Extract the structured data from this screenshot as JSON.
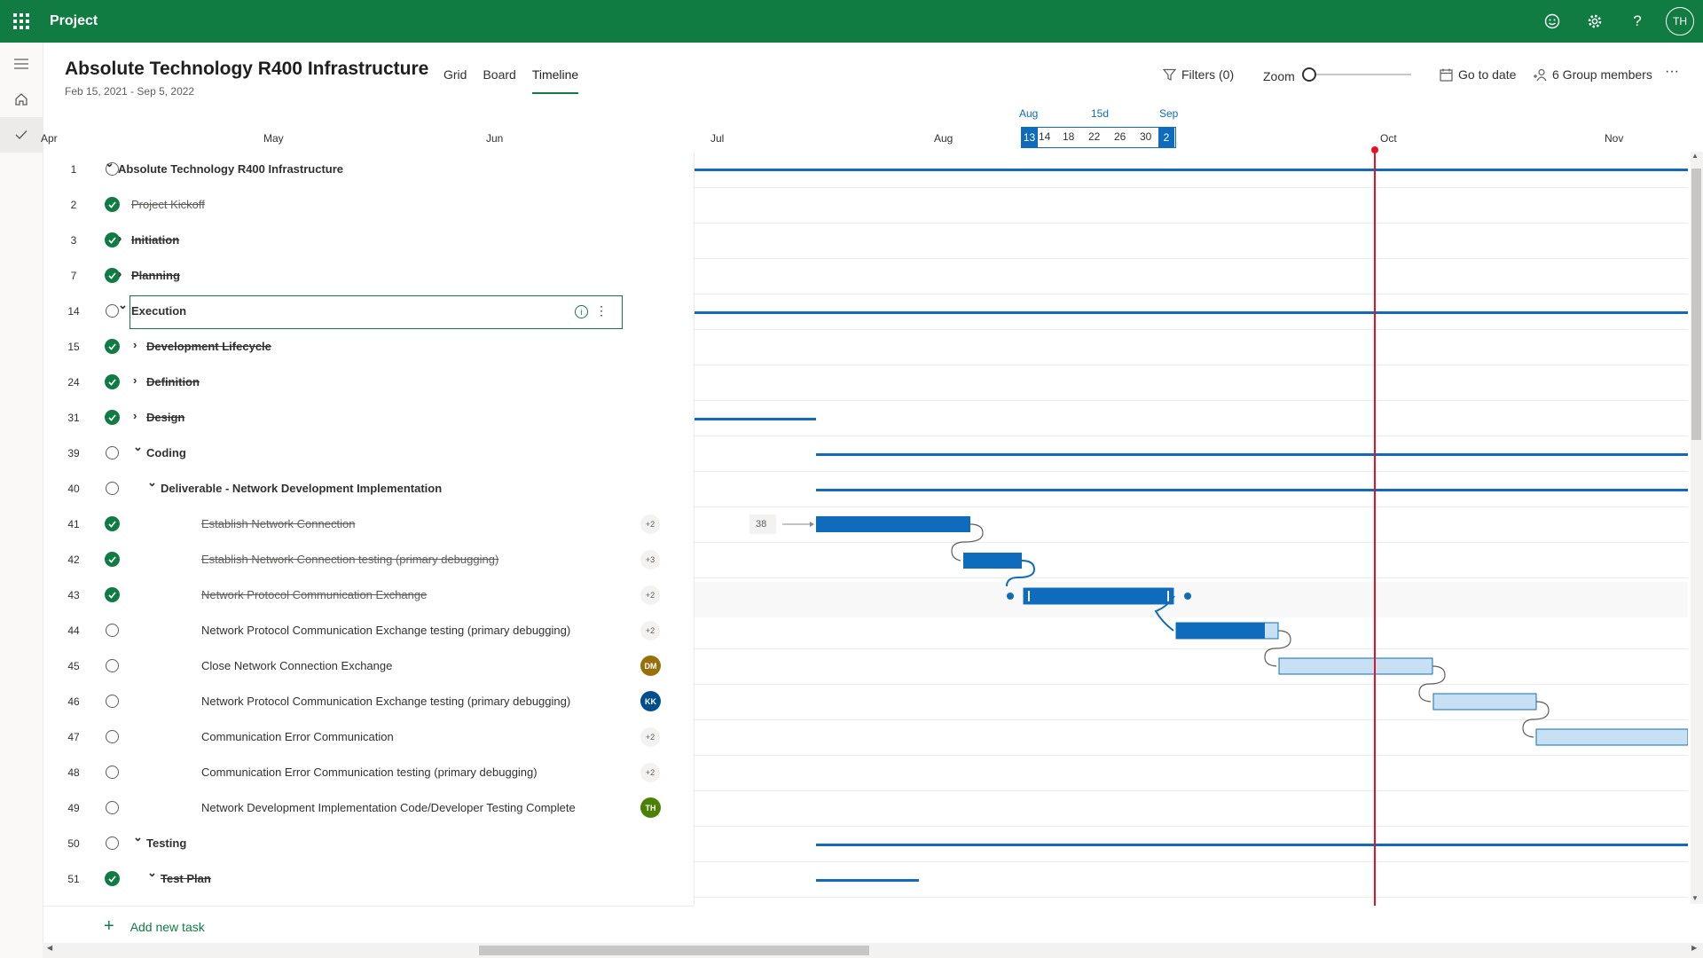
{
  "app": {
    "name": "Project",
    "user_initials": "TH"
  },
  "project": {
    "title": "Absolute Technology R400 Infrastructure",
    "dates": "Feb 15, 2021 - Sep 5, 2022"
  },
  "tabs": [
    "Grid",
    "Board",
    "Timeline"
  ],
  "active_tab": "Timeline",
  "commands": {
    "filters": "Filters (0)",
    "zoom": "Zoom",
    "go_to_date": "Go to date",
    "members": "6 Group members",
    "more": "···"
  },
  "timeline": {
    "months": [
      "Apr",
      "May",
      "Jun",
      "Jul",
      "Aug",
      "Oct",
      "Nov"
    ],
    "selection": {
      "start_month": "Aug",
      "duration": "15d",
      "end_month": "Sep",
      "days": [
        "13",
        "14",
        "18",
        "22",
        "26",
        "30",
        "2"
      ]
    },
    "lag_label": "38"
  },
  "tasks": [
    {
      "num": "1",
      "name": "Absolute Technology R400 Infrastructure",
      "done": false,
      "bold": true,
      "chevron": "down",
      "level": 0
    },
    {
      "num": "2",
      "name": "Project Kickoff",
      "done": true,
      "bold": false,
      "chevron": null,
      "level": 1
    },
    {
      "num": "3",
      "name": "Initiation",
      "done": true,
      "bold": true,
      "chevron": "right",
      "level": 1
    },
    {
      "num": "7",
      "name": "Planning",
      "done": true,
      "bold": true,
      "chevron": "right",
      "level": 1
    },
    {
      "num": "14",
      "name": "Execution",
      "done": false,
      "bold": true,
      "chevron": "down",
      "level": 1
    },
    {
      "num": "15",
      "name": "Development Lifecycle",
      "done": true,
      "bold": true,
      "chevron": "right",
      "level": 2
    },
    {
      "num": "24",
      "name": "Definition",
      "done": true,
      "bold": true,
      "chevron": "right",
      "level": 2
    },
    {
      "num": "31",
      "name": "Design",
      "done": true,
      "bold": true,
      "chevron": "right",
      "level": 2
    },
    {
      "num": "39",
      "name": "Coding",
      "done": false,
      "bold": true,
      "chevron": "down",
      "level": 2
    },
    {
      "num": "40",
      "name": "Deliverable - Network Development Implementation",
      "done": false,
      "bold": true,
      "chevron": "down",
      "level": 3
    },
    {
      "num": "41",
      "name": "Establish Network Connection",
      "done": true,
      "bold": false,
      "chevron": null,
      "level": 4,
      "badge": "+2"
    },
    {
      "num": "42",
      "name": "Establish Network Connection testing (primary debugging)",
      "done": true,
      "bold": false,
      "chevron": null,
      "level": 4,
      "badge": "+3"
    },
    {
      "num": "43",
      "name": "Network Protocol Communication Exchange",
      "done": true,
      "bold": false,
      "chevron": null,
      "level": 4,
      "badge": "+2"
    },
    {
      "num": "44",
      "name": "Network Protocol Communication Exchange testing (primary debugging)",
      "done": false,
      "bold": false,
      "chevron": null,
      "level": 4,
      "badge": "+2"
    },
    {
      "num": "45",
      "name": "Close Network Connection Exchange",
      "done": false,
      "bold": false,
      "chevron": null,
      "level": 4,
      "avatar": "DM",
      "avatar_color": "#986f0b"
    },
    {
      "num": "46",
      "name": "Network Protocol Communication Exchange testing (primary debugging)",
      "done": false,
      "bold": false,
      "chevron": null,
      "level": 4,
      "avatar": "KK",
      "avatar_color": "#004e8c"
    },
    {
      "num": "47",
      "name": "Communication Error Communication",
      "done": false,
      "bold": false,
      "chevron": null,
      "level": 4,
      "badge": "+2"
    },
    {
      "num": "48",
      "name": "Communication Error Communication testing (primary debugging)",
      "done": false,
      "bold": false,
      "chevron": null,
      "level": 4,
      "badge": "+2"
    },
    {
      "num": "49",
      "name": "Network Development Implementation Code/Developer Testing Complete",
      "done": false,
      "bold": false,
      "chevron": null,
      "level": 4,
      "avatar": "TH",
      "avatar_color": "#498205"
    },
    {
      "num": "50",
      "name": "Testing",
      "done": false,
      "bold": true,
      "chevron": "down",
      "level": 2
    },
    {
      "num": "51",
      "name": "Test Plan",
      "done": true,
      "bold": true,
      "chevron": "down",
      "level": 3
    }
  ],
  "add_task": "Add new task",
  "colors": {
    "brand": "#107c41",
    "bar": "#0f6cbd",
    "bar_light": "#c7e0f4",
    "today": "#e81123"
  }
}
